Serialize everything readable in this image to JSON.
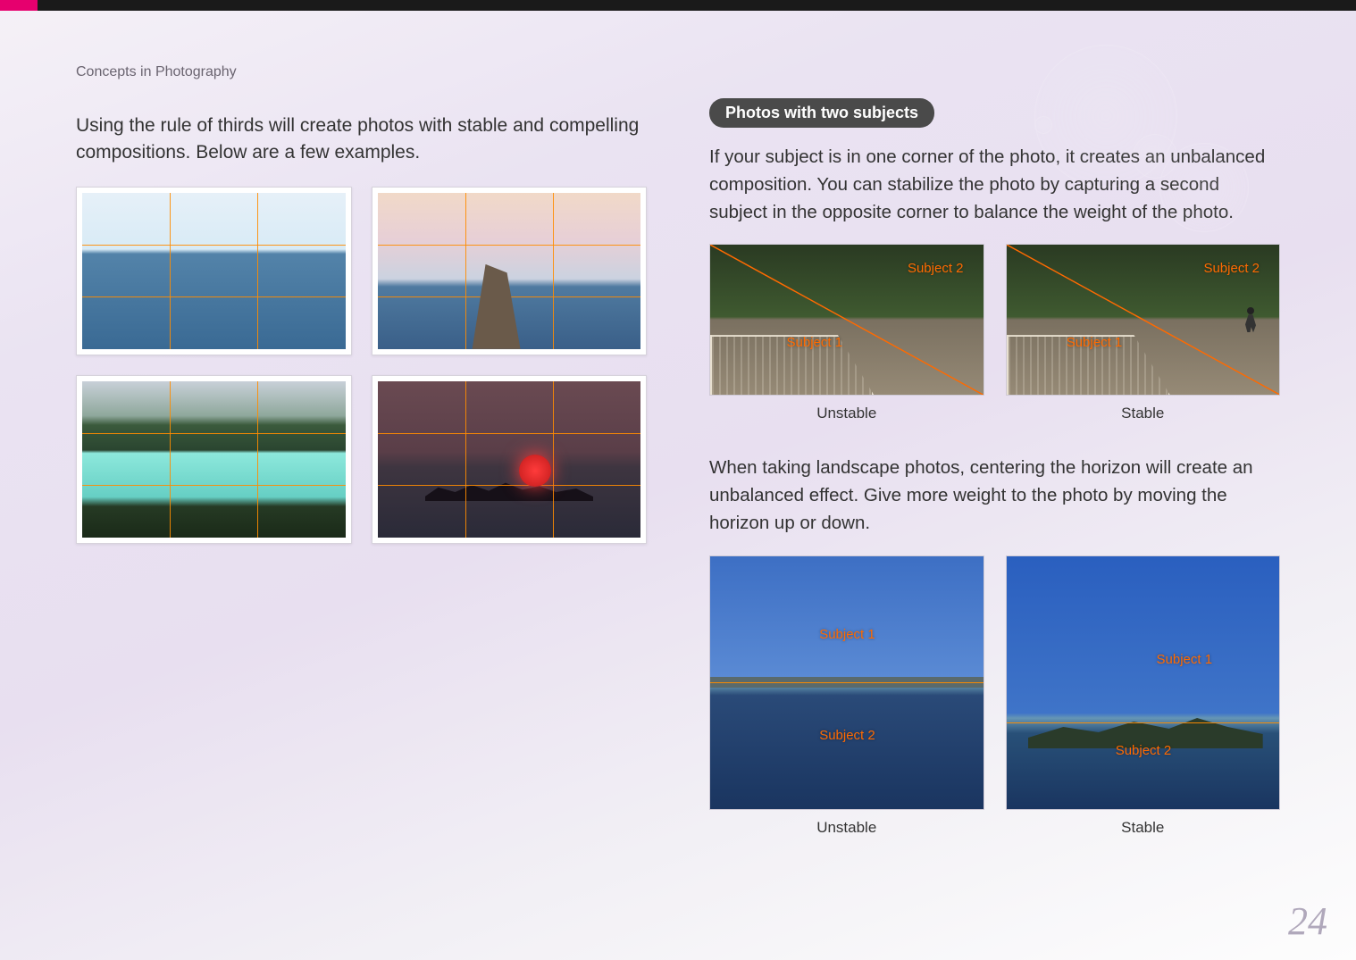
{
  "breadcrumb": "Concepts in Photography",
  "left": {
    "intro": "Using the rule of thirds will create photos with stable and compelling compositions. Below are a few examples."
  },
  "right": {
    "heading": "Photos with two subjects",
    "p1": "If your subject is in one corner of the photo, it creates an unbalanced composition. You can stabilize the photo by capturing a second subject in the opposite corner to balance the weight of the photo.",
    "p2": "When taking landscape photos, centering the horizon will create an unbalanced effect. Give more weight to the photo by moving the horizon up or down.",
    "labels": {
      "subject1": "Subject 1",
      "subject2": "Subject 2",
      "unstable": "Unstable",
      "stable": "Stable"
    }
  },
  "page_number": "24"
}
